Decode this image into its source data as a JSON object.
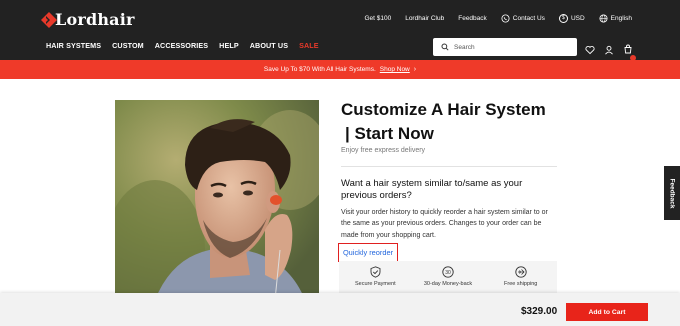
{
  "brand": {
    "name": "Lordhair",
    "color": "#e8392a"
  },
  "top_links": [
    {
      "label": "Get $100",
      "icon": ""
    },
    {
      "label": "Lordhair Club",
      "icon": ""
    },
    {
      "label": "Feedback",
      "icon": ""
    },
    {
      "label": "Contact Us",
      "icon": "whatsapp-icon"
    },
    {
      "label": "USD",
      "icon": "dollar-icon"
    },
    {
      "label": "English",
      "icon": "globe-icon"
    }
  ],
  "nav": [
    "HAIR SYSTEMS",
    "CUSTOM",
    "ACCESSORIES",
    "HELP",
    "ABOUT US",
    "SALE"
  ],
  "search": {
    "placeholder": "Search"
  },
  "header_icons": [
    "heart-icon",
    "user-icon",
    "cart-icon"
  ],
  "promo": {
    "text": "Save Up To $70 With All Hair Systems.",
    "link": "Shop Now"
  },
  "product": {
    "title_line1": "Customize A Hair System",
    "title_line2": "| Start Now",
    "subtitle": "Enjoy free express delivery",
    "similar_title": "Want a hair system similar to/same as your previous orders?",
    "similar_text": "Visit your order history to quickly reorder a hair system similar to or the same as your previous orders. Changes to your order can be made from your shopping cart.",
    "reorder_link": "Quickly reorder",
    "features": [
      {
        "label": "Secure Payment",
        "icon": "shield-check-icon"
      },
      {
        "label": "30-day Money-back",
        "icon": "money-back-30-icon"
      },
      {
        "label": "Free shipping",
        "icon": "airplane-icon"
      }
    ]
  },
  "feedback_tab": "Feedback",
  "bottom_bar": {
    "price": "$329.00",
    "button": "Add to Cart"
  },
  "colors": {
    "header_bg": "#222222",
    "promo_bg": "#ef3a29",
    "button_bg": "#e8241a",
    "link": "#2266dd"
  }
}
